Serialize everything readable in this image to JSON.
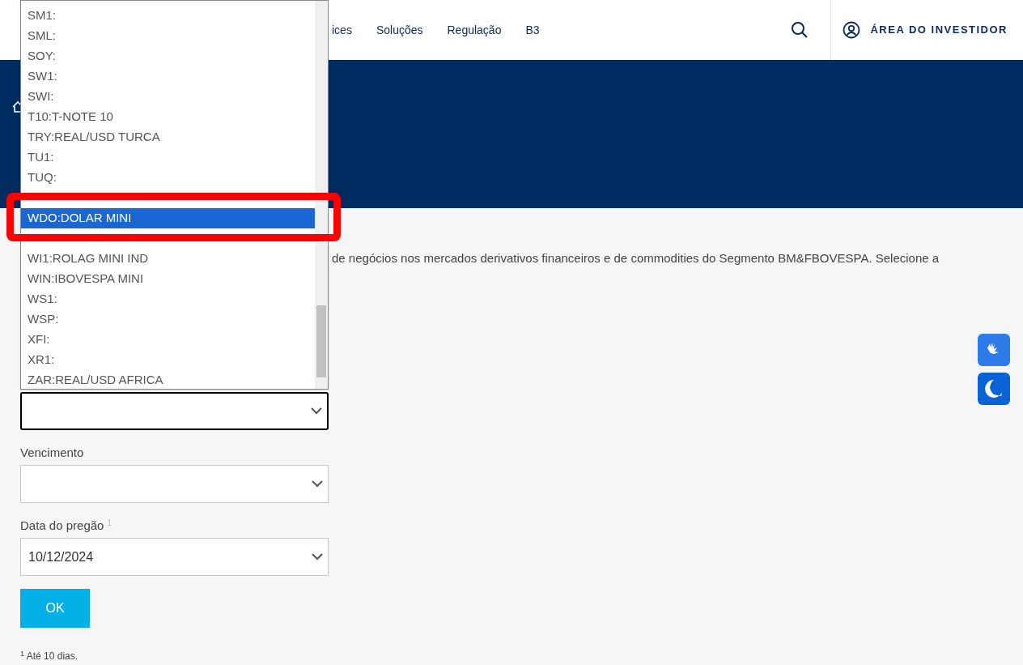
{
  "header": {
    "nav": [
      "ices",
      "Soluções",
      "Regulação",
      "B3"
    ],
    "investor_link": "ÁREA DO INVESTIDOR"
  },
  "intro_text": "de negócios nos mercados derivativos financeiros e de commodities do Segmento BM&FBOVESPA. Selecione a",
  "form": {
    "fields": [
      {
        "focused": true
      },
      {
        "label": "Vencimento",
        "focused": false
      },
      {
        "label": "Data do pregão $^{1}$",
        "value": "10/12/2024",
        "focused": false
      }
    ],
    "submit": "OK",
    "footnote": "$^{1}$ Até 10 dias."
  },
  "dropdown": {
    "options": [
      {
        "label": "SM1:",
        "selected": false
      },
      {
        "label": "SML:",
        "selected": false
      },
      {
        "label": "SOY:",
        "selected": false
      },
      {
        "label": "SW1:",
        "selected": false
      },
      {
        "label": "SWI:",
        "selected": false
      },
      {
        "label": "T10:T-NOTE 10",
        "selected": false
      },
      {
        "label": "TRY:REAL/USD TURCA",
        "selected": false
      },
      {
        "label": "TU1:",
        "selected": false
      },
      {
        "label": "TUQ:",
        "selected": false
      },
      {
        "label": "WDO:DOLAR MINI",
        "selected": true
      },
      {
        "label": "WI1:ROLAG MINI IND",
        "selected": false
      },
      {
        "label": "WIN:IBOVESPA MINI",
        "selected": false
      },
      {
        "label": "WS1:",
        "selected": false
      },
      {
        "label": "WSP:",
        "selected": false
      },
      {
        "label": "XFI:",
        "selected": false
      },
      {
        "label": "XR1:",
        "selected": false
      },
      {
        "label": "ZAR:REAL/USD AFRICA",
        "selected": false
      }
    ],
    "annotation": {
      "kind": "highlight-box"
    }
  }
}
